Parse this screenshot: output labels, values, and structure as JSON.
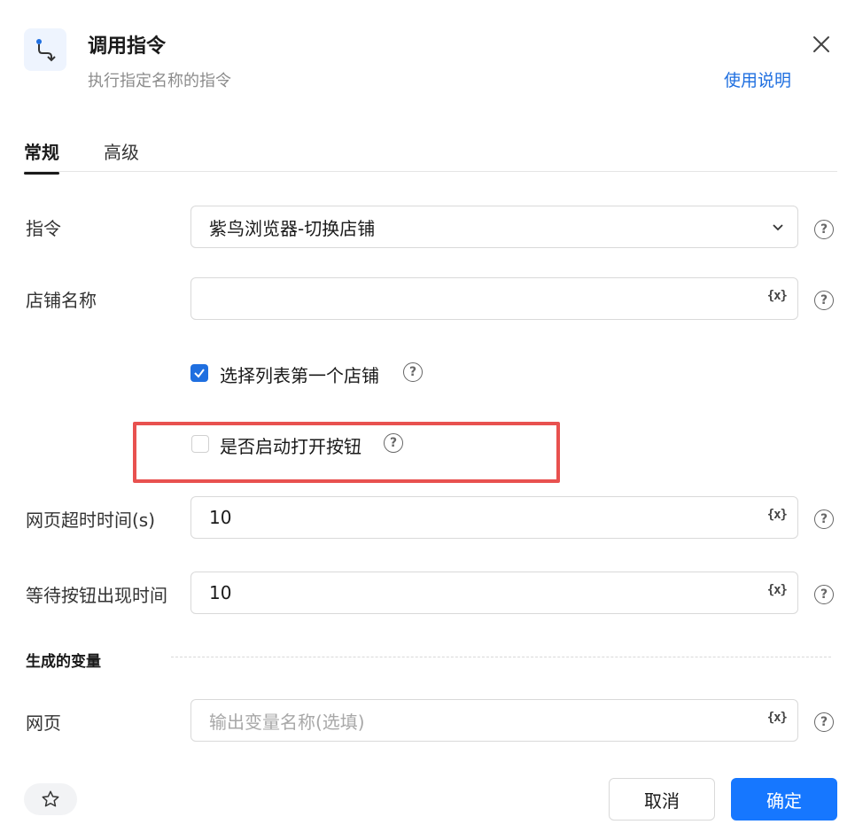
{
  "header": {
    "icon": "flow-connector-icon",
    "title": "调用指令",
    "subtitle": "执行指定名称的指令",
    "help_link": "使用说明",
    "close_icon": "close-icon"
  },
  "tabs": [
    {
      "label": "常规",
      "active": true
    },
    {
      "label": "高级",
      "active": false
    }
  ],
  "form": {
    "command": {
      "label": "指令",
      "value": "紫鸟浏览器-切换店铺"
    },
    "store_name": {
      "label": "店铺名称",
      "value": ""
    },
    "select_first_store": {
      "label": "选择列表第一个店铺",
      "checked": true
    },
    "enable_open_button": {
      "label": "是否启动打开按钮",
      "checked": false
    },
    "page_timeout": {
      "label": "网页超时时间(s)",
      "value": "10"
    },
    "wait_button_time": {
      "label": "等待按钮出现时间",
      "value": "10"
    },
    "variable_button": "{x}",
    "help_glyph": "?"
  },
  "generated_vars": {
    "section_title": "生成的变量",
    "webpage": {
      "label": "网页",
      "placeholder": "输出变量名称(选填)"
    }
  },
  "footer": {
    "cancel_label": "取消",
    "ok_label": "确定",
    "favorite_icon": "star-icon"
  },
  "colors": {
    "accent": "#1677ff",
    "link": "#1f6fe0",
    "highlight": "#e8514f"
  }
}
